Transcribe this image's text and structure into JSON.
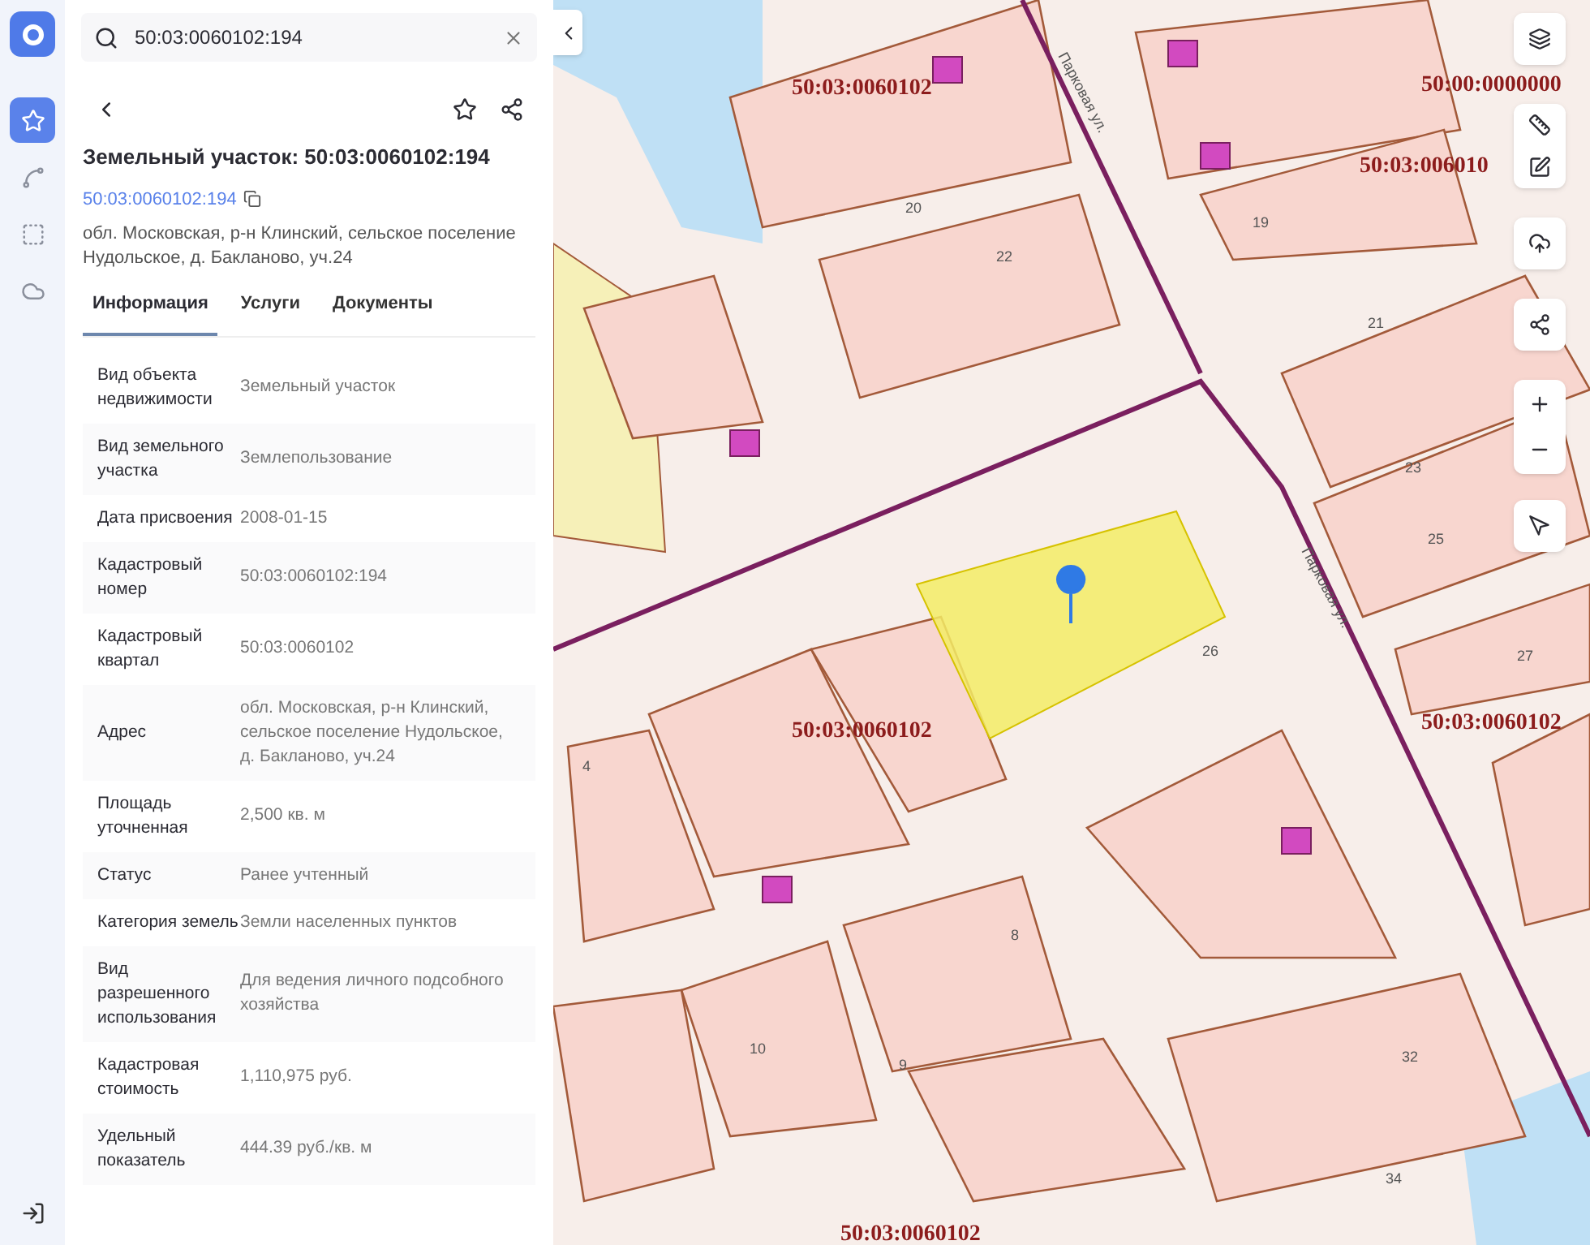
{
  "search": {
    "value": "50:03:0060102:194"
  },
  "rail": [
    {
      "selected": true
    },
    {
      "selected": false
    },
    {
      "selected": false
    },
    {
      "selected": false
    }
  ],
  "card": {
    "title": "Земельный участок: 50:03:0060102:194",
    "number": "50:03:0060102:194",
    "address": "обл. Московская, р-н Клинский, сельское поселение Нудольское, д. Бакланово, уч.24"
  },
  "tabs": [
    {
      "label": "Информация",
      "selected": true
    },
    {
      "label": "Услуги",
      "selected": false
    },
    {
      "label": "Документы",
      "selected": false
    }
  ],
  "rows": [
    {
      "label": "Вид объекта недвижимости",
      "value": "Земельный участок"
    },
    {
      "label": "Вид земельного участка",
      "value": "Землепользование"
    },
    {
      "label": "Дата присвоения",
      "value": "2008-01-15"
    },
    {
      "label": "Кадастровый номер",
      "value": "50:03:0060102:194"
    },
    {
      "label": "Кадастровый квартал",
      "value": "50:03:0060102"
    },
    {
      "label": "Адрес",
      "value": "обл. Московская, р-н Клинский, сельское поселение Нудольское, д. Бакланово, уч.24"
    },
    {
      "label": "Площадь уточненная",
      "value": "2,500 кв. м"
    },
    {
      "label": "Статус",
      "value": "Ранее учтенный"
    },
    {
      "label": "Категория земель",
      "value": "Земли населенных пунктов"
    },
    {
      "label": "Вид разрешенного использования",
      "value": "Для ведения личного подсобного хозяйства"
    },
    {
      "label": "Кадастровая стоимость",
      "value": "1,110,975 руб."
    },
    {
      "label": "Удельный показатель",
      "value": "444.39 руб./кв. м"
    }
  ],
  "map": {
    "quarter_labels": [
      "50:03:0060102",
      "50:00:0000000",
      "50:03:006010",
      "50:03:0060102",
      "50:03:0060102",
      "50:03:0060102"
    ],
    "streets": [
      "Парковая ул.",
      "Парковая ул."
    ],
    "house_numbers": [
      "20",
      "22",
      "19",
      "21",
      "23",
      "25",
      "26",
      "27",
      "4",
      "8",
      "10",
      "9",
      "32",
      "34"
    ]
  }
}
